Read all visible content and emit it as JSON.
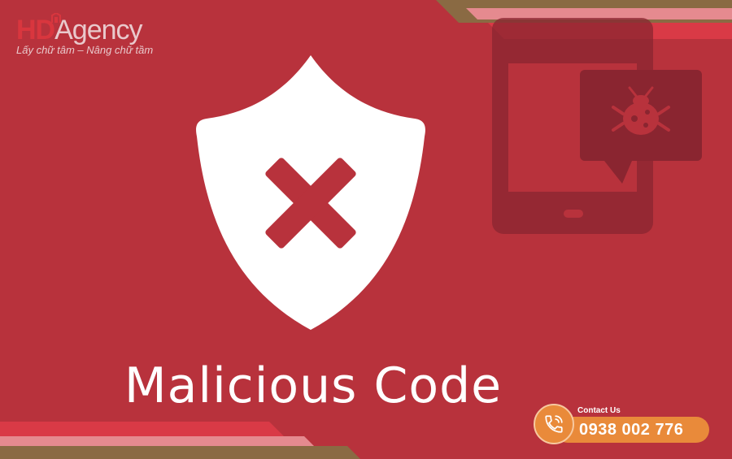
{
  "logo": {
    "brand_part1": "HD",
    "brand_part2": "Agency",
    "tagline": "Lấy chữ tâm – Nâng chữ tầm"
  },
  "heading": "Malicious Code",
  "contact": {
    "label": "Contact Us",
    "phone": "0938 002 776"
  },
  "icons": {
    "shield": "shield-x-icon",
    "tablet": "tablet-bug-icon",
    "phone": "phone-icon"
  },
  "colors": {
    "background": "#b8323c",
    "accent": "#d93a46",
    "contact": "#e98a3a",
    "brown": "#8a6a43"
  }
}
